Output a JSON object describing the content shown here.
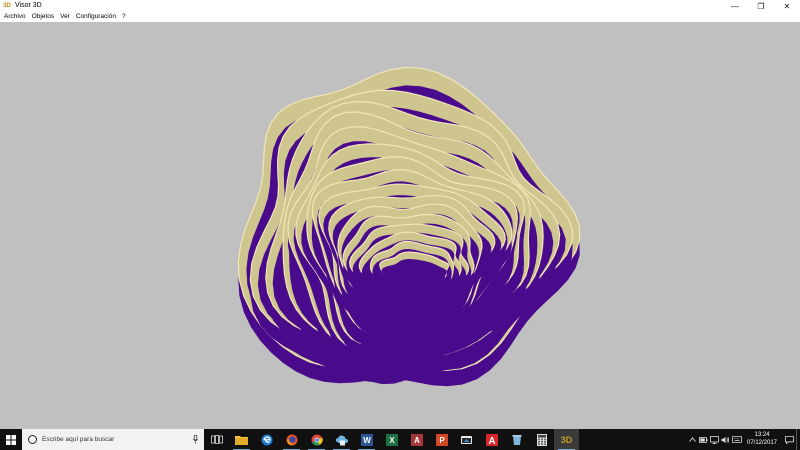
{
  "window": {
    "title": "Visor 3D",
    "app_icon_text": "3D",
    "controls": {
      "minimize": "—",
      "restore": "❐",
      "close": "✕"
    }
  },
  "menubar": {
    "items": [
      "Archivo",
      "Objetos",
      "Ver",
      "Configuración",
      "?"
    ]
  },
  "viewport": {
    "background": "#c0c0c0",
    "model_colors": {
      "bench_face": "#4a0a8c",
      "bench_top": "#cfc58e",
      "bench_highlight": "#f1e6b7"
    }
  },
  "taskbar": {
    "search_placeholder": "Escribe aquí para buscar",
    "pinned_apps": [
      {
        "name": "task-view-icon"
      },
      {
        "name": "file-explorer-icon"
      },
      {
        "name": "edge-icon"
      },
      {
        "name": "firefox-icon"
      },
      {
        "name": "chrome-icon"
      },
      {
        "name": "cloud-app-icon"
      },
      {
        "name": "word-icon"
      },
      {
        "name": "excel-icon"
      },
      {
        "name": "access-icon"
      },
      {
        "name": "powerpoint-icon"
      },
      {
        "name": "cloud-store-icon"
      },
      {
        "name": "autocad-icon"
      },
      {
        "name": "recycle-app-icon"
      },
      {
        "name": "calculator-icon"
      },
      {
        "name": "visor-3d-icon"
      }
    ],
    "visor_label": "3D"
  },
  "tray": {
    "time": "13:24",
    "date": "07/12/2017"
  }
}
